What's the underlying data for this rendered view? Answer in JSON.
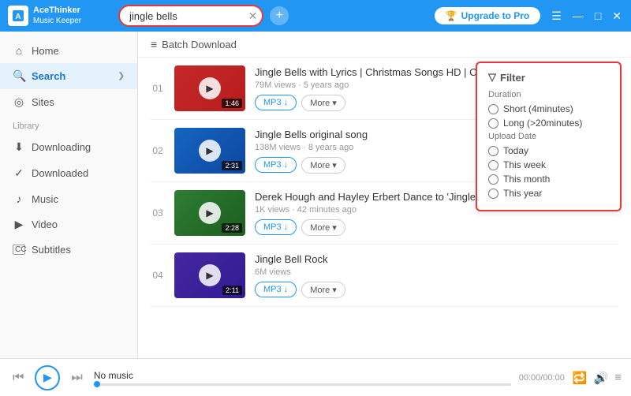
{
  "app": {
    "name": "AceThinker",
    "subtitle": "Music Keeper"
  },
  "titlebar": {
    "search_value": "jingle bells",
    "upgrade_label": "Upgrade to Pro",
    "menu_icon": "☰",
    "minimize": "—",
    "maximize": "□",
    "close": "✕"
  },
  "sidebar": {
    "items": [
      {
        "id": "home",
        "label": "Home",
        "icon": "⌂",
        "active": false
      },
      {
        "id": "search",
        "label": "Search",
        "icon": "🔍",
        "active": true
      },
      {
        "id": "sites",
        "label": "Sites",
        "icon": "◎",
        "active": false
      }
    ],
    "library_label": "Library",
    "library_items": [
      {
        "id": "downloading",
        "label": "Downloading",
        "icon": "⬇",
        "active": false
      },
      {
        "id": "downloaded",
        "label": "Downloaded",
        "icon": "✓",
        "active": false
      },
      {
        "id": "music",
        "label": "Music",
        "icon": "♪",
        "active": false
      },
      {
        "id": "video",
        "label": "Video",
        "icon": "▶",
        "active": false
      },
      {
        "id": "subtitles",
        "label": "Subtitles",
        "icon": "CC",
        "active": false
      }
    ]
  },
  "batch_download": "Batch Download",
  "results": [
    {
      "number": "01",
      "title": "Jingle Bells with Lyrics | Christmas Songs HD | Chr...",
      "meta": "79M views · 5 years ago",
      "duration": "1:46",
      "thumb_class": "thumb-1"
    },
    {
      "number": "02",
      "title": "Jingle Bells original song",
      "meta": "138M views · 8 years ago",
      "duration": "2:31",
      "thumb_class": "thumb-2"
    },
    {
      "number": "03",
      "title": "Derek Hough and Hayley Erbert Dance to 'Jingle Bells' and 'Hey S...",
      "meta": "1K views · 42 minutes ago",
      "duration": "2:28",
      "thumb_class": "thumb-3"
    },
    {
      "number": "04",
      "title": "Jingle Bell Rock",
      "meta": "6M views",
      "duration": "2:11",
      "thumb_class": "thumb-4"
    }
  ],
  "buttons": {
    "mp3": "MP3 ↓",
    "more": "More ▾"
  },
  "filter": {
    "title": "Filter",
    "duration_label": "Duration",
    "options_duration": [
      {
        "id": "short",
        "label": "Short (4minutes)"
      },
      {
        "id": "long",
        "label": "Long (>20minutes)"
      }
    ],
    "upload_label": "Upload Date",
    "options_upload": [
      {
        "id": "today",
        "label": "Today"
      },
      {
        "id": "week",
        "label": "This week"
      },
      {
        "id": "month",
        "label": "This month"
      },
      {
        "id": "year",
        "label": "This year"
      }
    ]
  },
  "player": {
    "track_name": "No music",
    "time": "00:00/00:00",
    "progress": 0
  }
}
